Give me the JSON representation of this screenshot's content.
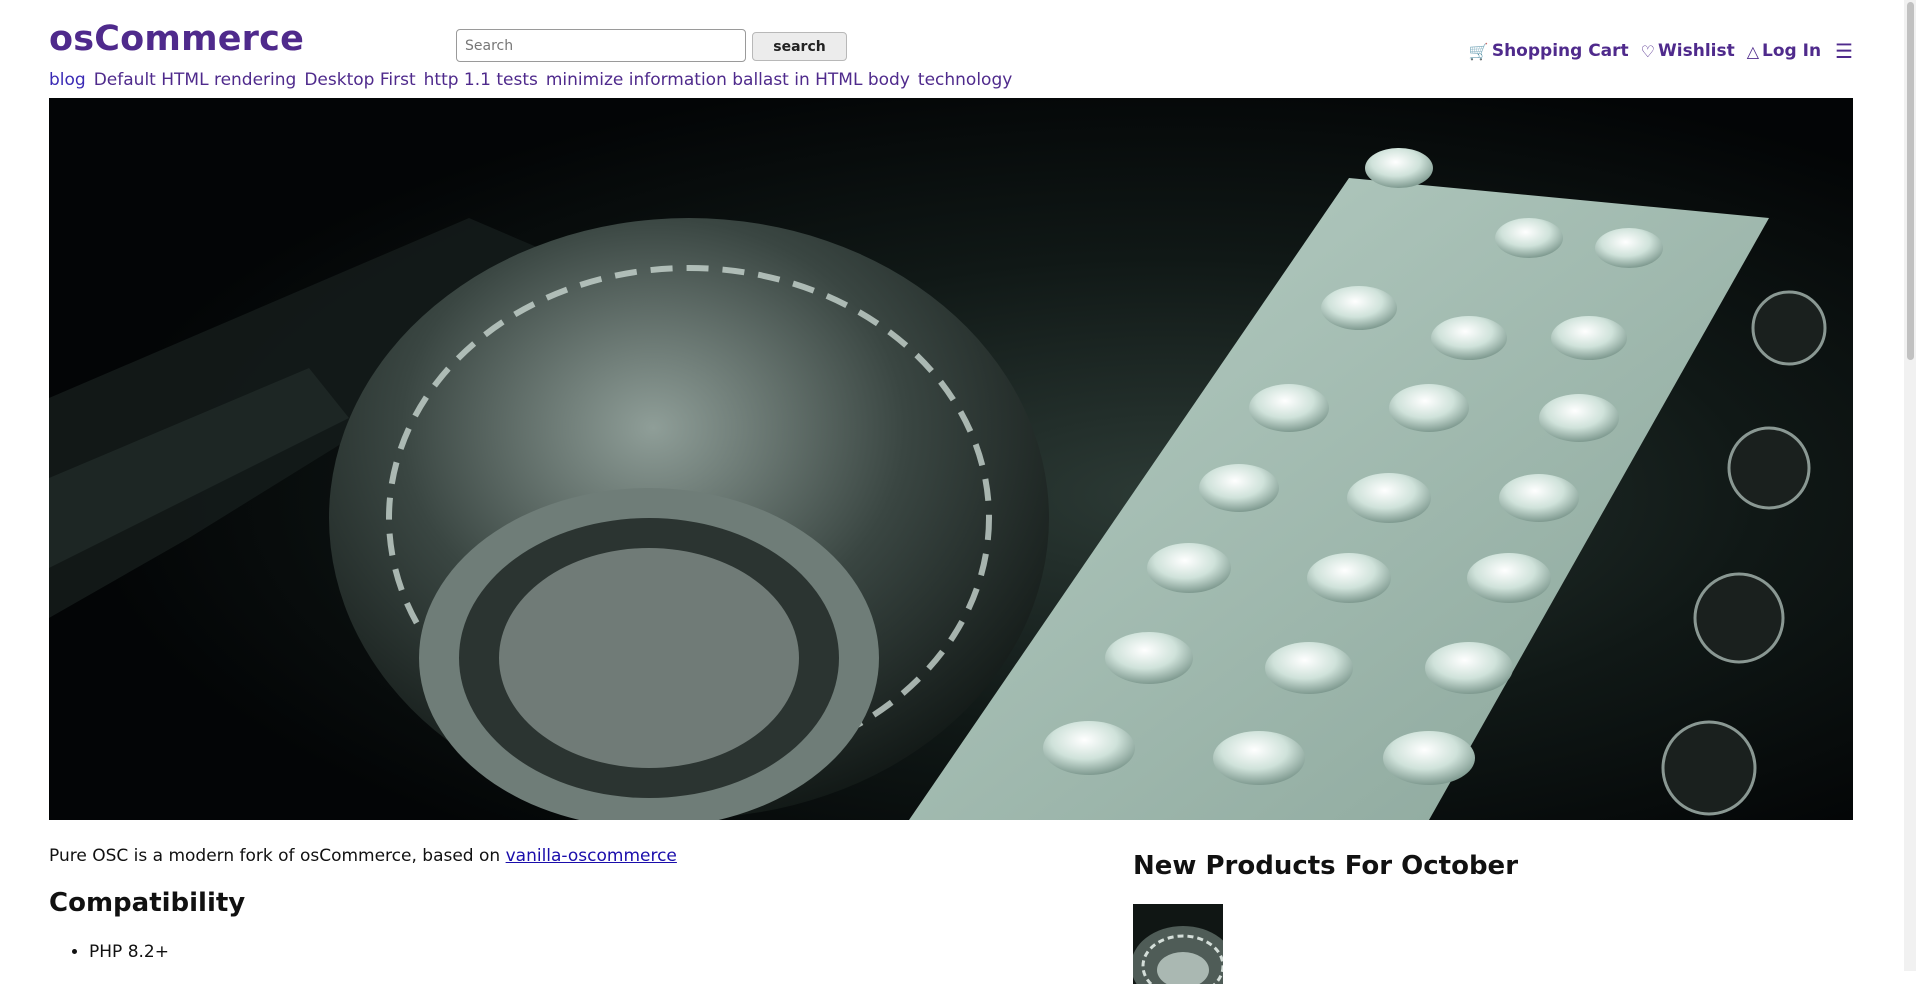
{
  "brand": {
    "name": "osCommerce"
  },
  "search": {
    "placeholder": "Search",
    "button_label": "search"
  },
  "header_nav": {
    "cart_label": "Shopping Cart",
    "cart_icon": "cart-icon",
    "wishlist_label": "Wishlist",
    "wishlist_icon": "heart-icon",
    "login_label": "Log In",
    "login_icon": "user-icon",
    "menu_icon": "hamburger-menu-icon"
  },
  "categories": [
    "blog",
    "Default HTML rendering",
    "Desktop First",
    "http 1.1 tests",
    "minimize information ballast in HTML body",
    "technology"
  ],
  "hero": {
    "subject": "enigma-machine-keyboard-and-rotors"
  },
  "content": {
    "intro_text": "Pure OSC is a modern fork of osCommerce, based on ",
    "intro_link": "vanilla-oscommerce",
    "compat_heading": "Compatibility",
    "compat_items": [
      "PHP 8.2+"
    ]
  },
  "sidebar": {
    "new_products_heading": "New Products For October"
  },
  "colors": {
    "brand": "#4f2a8c",
    "link": "#1a0dab",
    "hero_dark": "#05080a",
    "hero_key": "#c9ddd4"
  }
}
